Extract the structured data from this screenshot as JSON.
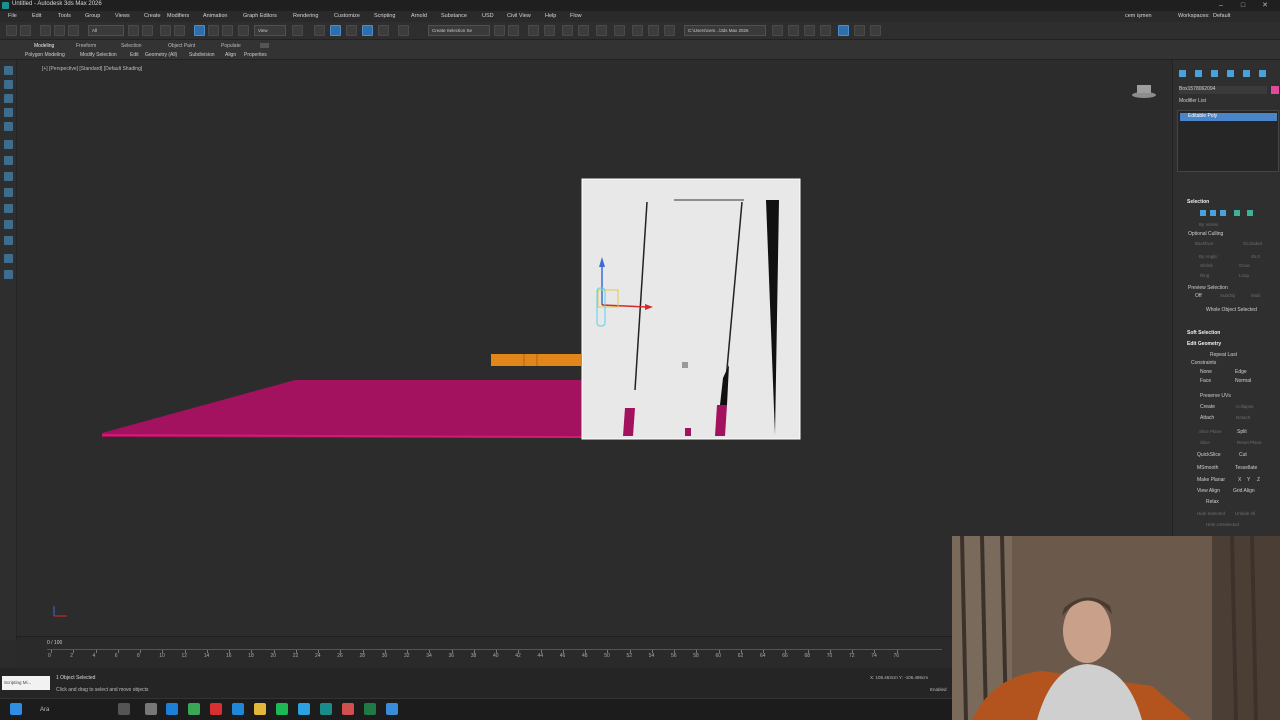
{
  "window": {
    "title": "Untitled - Autodesk 3ds Max 2026"
  },
  "menu": {
    "items": [
      "File",
      "Edit",
      "Tools",
      "Group",
      "Views",
      "Create",
      "Modifiers",
      "Animation",
      "Graph Editors",
      "Rendering",
      "Customize",
      "Scripting",
      "Arnold",
      "Substance",
      "USD",
      "Civil View",
      "Help",
      "Flow"
    ],
    "user": "cem işmen",
    "workspace_label": "Workspaces:",
    "workspace_value": "Default"
  },
  "toolbar": {
    "selection_filter": "All",
    "view_dropdown": "View",
    "create_selection_set": "Create Selection Se",
    "project_path": "C:\\Users\\cem...\\3ds Max 2026"
  },
  "ribbon": {
    "tabs": [
      "Modeling",
      "Freeform",
      "Selection",
      "Object Paint",
      "Populate"
    ],
    "active_tab": "Modeling",
    "panels": [
      "Polygon Modeling",
      "Modify Selection",
      "Edit",
      "Geometry (All)",
      "Subdivision",
      "Align",
      "Properties"
    ]
  },
  "viewport": {
    "label": "[+] [Perspective] [Standard] [Default Shading]",
    "colors": {
      "plane": "#a3125e",
      "box": "#e8e8e8",
      "orange": "#e0861b",
      "background": "#2c2c2c"
    }
  },
  "timeline": {
    "counter": "0 / 100",
    "ticks": [
      "0",
      "2",
      "4",
      "6",
      "8",
      "10",
      "12",
      "14",
      "16",
      "18",
      "20",
      "22",
      "24",
      "26",
      "28",
      "30",
      "32",
      "34",
      "36",
      "38",
      "40",
      "42",
      "44",
      "46",
      "48",
      "50",
      "52",
      "54",
      "56",
      "58",
      "60",
      "62",
      "64",
      "66",
      "68",
      "70",
      "72",
      "74",
      "76"
    ]
  },
  "status": {
    "selected": "1 Object Selected",
    "prompt": "Click and drag to select and move objects",
    "scripting_label": "Scripting Mi...",
    "coords": "X: 108.463cm   Y: -106.486cm",
    "enabled": "Enabled"
  },
  "command_panel": {
    "object_name": "Box1578062094",
    "modifier_list": "Modifier List",
    "stack_item": "Editable Poly",
    "selection_header": "Selection",
    "by_vertex": "By Vertex",
    "ignore_backfacing": "Ignore Backfacing",
    "occluded": "Occluded",
    "by_angle": "By Angle:",
    "by_angle_value": "45.0",
    "shrink": "Shrink",
    "grow": "Grow",
    "ring": "Ring",
    "loop": "Loop",
    "get_stack_selection": "Get Stack Selection",
    "preview_selection": "Preview Selection",
    "preview_off": "Off",
    "sub_obj": "SubObj",
    "multi": "Multi",
    "whole_object_selected": "Whole Object Selected",
    "soft_selection": "Soft Selection",
    "edit_geometry": "Edit Geometry",
    "repeat_last": "Repeat Last",
    "constraints": "Constraints",
    "c_none": "None",
    "c_edge": "Edge",
    "c_face": "Face",
    "c_normal": "Normal",
    "preserve_uvs": "Preserve UVs",
    "create": "Create",
    "collapse": "Collapse",
    "attach": "Attach",
    "detach": "Detach",
    "slice_plane": "Slice Plane",
    "split": "Split",
    "slice": "Slice",
    "reset_plane": "Reset Plane",
    "quickslice": "QuickSlice",
    "cut": "Cut",
    "msmooth": "MSmooth",
    "tessellate": "Tessellate",
    "make_planar": "Make Planar",
    "x": "X",
    "y": "Y",
    "z": "Z",
    "view_align": "View Align",
    "grid_align": "Grid Align",
    "relax": "Relax",
    "hide_selected": "Hide Selected",
    "unhide_all": "Unhide All",
    "hide_unselected": "Hide Unselected",
    "optional_culling": "Optional Culling",
    "backface": "Backface",
    "occluded_c": "Occluded"
  },
  "taskbar": {
    "search_placeholder": "Ara"
  }
}
